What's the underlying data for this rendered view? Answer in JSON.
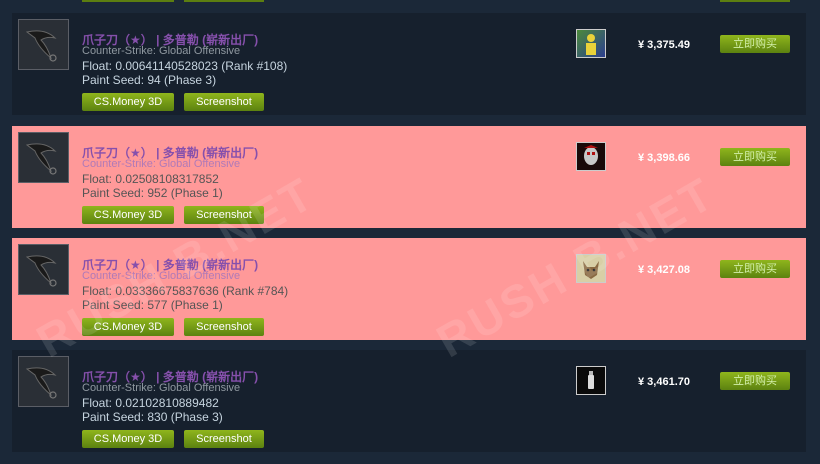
{
  "common": {
    "item_name": "爪子刀（★） | 多普勒 (崭新出厂)",
    "game": "Counter-Strike: Global Offensive",
    "btn_3d": "CS.Money 3D",
    "btn_screenshot": "Screenshot",
    "buy_label": "立即购买"
  },
  "listings": [
    {
      "float": "Float: 0.00641140528023 (Rank #108)",
      "seed": "Paint Seed: 94 (Phase 3)",
      "price": "¥ 3,375.49",
      "sticker_icon": "yellow-character-icon",
      "highlighted": false
    },
    {
      "float": "Float: 0.02508108317852",
      "seed": "Paint Seed: 952 (Phase 1)",
      "price": "¥ 3,398.66",
      "sticker_icon": "red-mask-icon",
      "highlighted": true
    },
    {
      "float": "Float: 0.03336675837636 (Rank #784)",
      "seed": "Paint Seed: 577 (Phase 1)",
      "price": "¥ 3,427.08",
      "sticker_icon": "wolf-icon",
      "highlighted": true
    },
    {
      "float": "Float: 0.02102810889482",
      "seed": "Paint Seed: 830 (Phase 3)",
      "price": "¥ 3,461.70",
      "sticker_icon": "spray-can-icon",
      "highlighted": false
    }
  ],
  "watermark": "RUSH B.NET",
  "colors": {
    "name": "#8650ac",
    "highlight": "#ff9999",
    "button": "#6a9c14"
  }
}
